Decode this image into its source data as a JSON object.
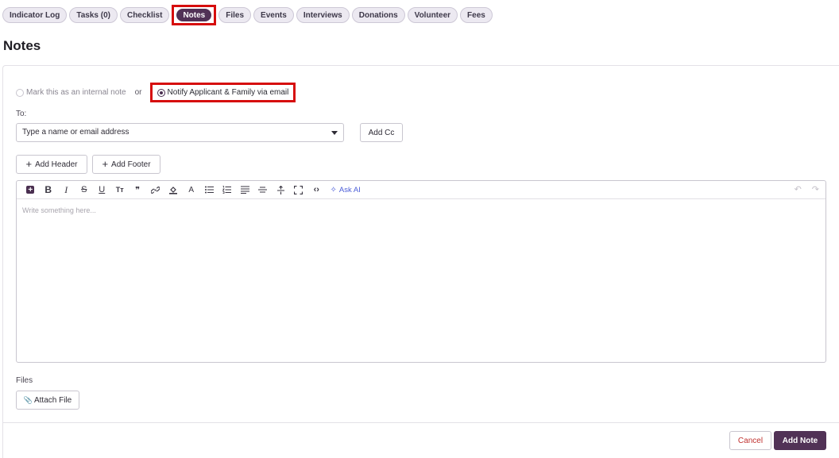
{
  "tabs": [
    {
      "label": "Indicator Log"
    },
    {
      "label": "Tasks (0)"
    },
    {
      "label": "Checklist"
    },
    {
      "label": "Notes"
    },
    {
      "label": "Files"
    },
    {
      "label": "Events"
    },
    {
      "label": "Interviews"
    },
    {
      "label": "Donations"
    },
    {
      "label": "Volunteer"
    },
    {
      "label": "Fees"
    }
  ],
  "page_title": "Notes",
  "note_type": {
    "internal_label": "Mark this as an internal note",
    "or_label": "or",
    "notify_label": "Notify Applicant & Family via email",
    "selected": "notify"
  },
  "recipients": {
    "to_label": "To:",
    "placeholder": "Type a name or email address",
    "add_cc_label": "Add Cc"
  },
  "header_footer": {
    "add_header_label": "Add Header",
    "add_footer_label": "Add Footer"
  },
  "editor": {
    "toolbar": [
      {
        "icon": "block-insert-icon",
        "glyph": "+"
      },
      {
        "icon": "bold-icon",
        "glyph": "B"
      },
      {
        "icon": "italic-icon",
        "glyph": "I"
      },
      {
        "icon": "strikethrough-icon",
        "glyph": "S"
      },
      {
        "icon": "underline-icon",
        "glyph": "U"
      },
      {
        "icon": "text-size-icon",
        "glyph": "Tт"
      },
      {
        "icon": "quote-icon",
        "glyph": "❞"
      },
      {
        "icon": "link-icon",
        "glyph": "🔗"
      },
      {
        "icon": "highlight-icon",
        "glyph": "◈"
      },
      {
        "icon": "font-color-icon",
        "glyph": "A"
      },
      {
        "icon": "bullet-list-icon",
        "glyph": "☰"
      },
      {
        "icon": "numbered-list-icon",
        "glyph": "≡"
      },
      {
        "icon": "align-icon",
        "glyph": "≣"
      },
      {
        "icon": "horizontal-rule-icon",
        "glyph": "⊟"
      },
      {
        "icon": "clear-format-icon",
        "glyph": "⤧"
      },
      {
        "icon": "fullscreen-icon",
        "glyph": "⛶"
      },
      {
        "icon": "code-view-icon",
        "glyph": "‹›"
      }
    ],
    "ask_ai_label": "Ask AI",
    "placeholder": "Write something here..."
  },
  "files": {
    "label": "Files",
    "attach_label": "Attach File"
  },
  "actions": {
    "cancel_label": "Cancel",
    "submit_label": "Add Note"
  },
  "colors": {
    "brand": "#513256",
    "highlight_box": "#d60d0d",
    "cancel_text": "#c0312f",
    "ai_accent": "#4d5fd8"
  }
}
